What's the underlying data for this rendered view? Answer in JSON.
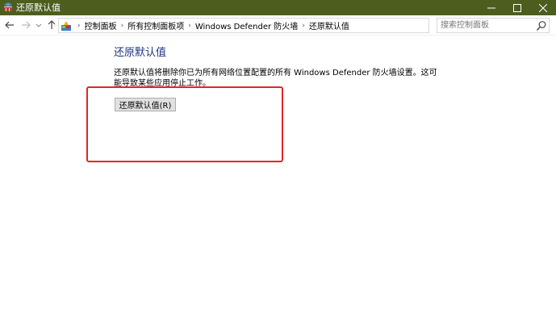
{
  "window": {
    "title": "还原默认值",
    "controls": {
      "minimize": "─",
      "maximize": "☐",
      "close": "✕"
    }
  },
  "nav": {
    "back": "←",
    "forward": "→",
    "recent": "⌄",
    "up": "↑"
  },
  "address": {
    "breadcrumbs": [
      "控制面板",
      "所有控制面板项",
      "Windows Defender 防火墙",
      "还原默认值"
    ],
    "separator": "›",
    "dropdown": "⌄",
    "refresh": "↻"
  },
  "search": {
    "placeholder": "搜索控制面板",
    "value": ""
  },
  "content": {
    "heading": "还原默认值",
    "description": "还原默认值将删除你已为所有网络位置配置的所有 Windows Defender 防火墙设置。这可能导致某些应用停止工作。",
    "restore_button": "还原默认值(R)"
  },
  "colors": {
    "titlebar": "#4c5e1e",
    "heading": "#1e3287",
    "highlight": "#e2262b"
  }
}
